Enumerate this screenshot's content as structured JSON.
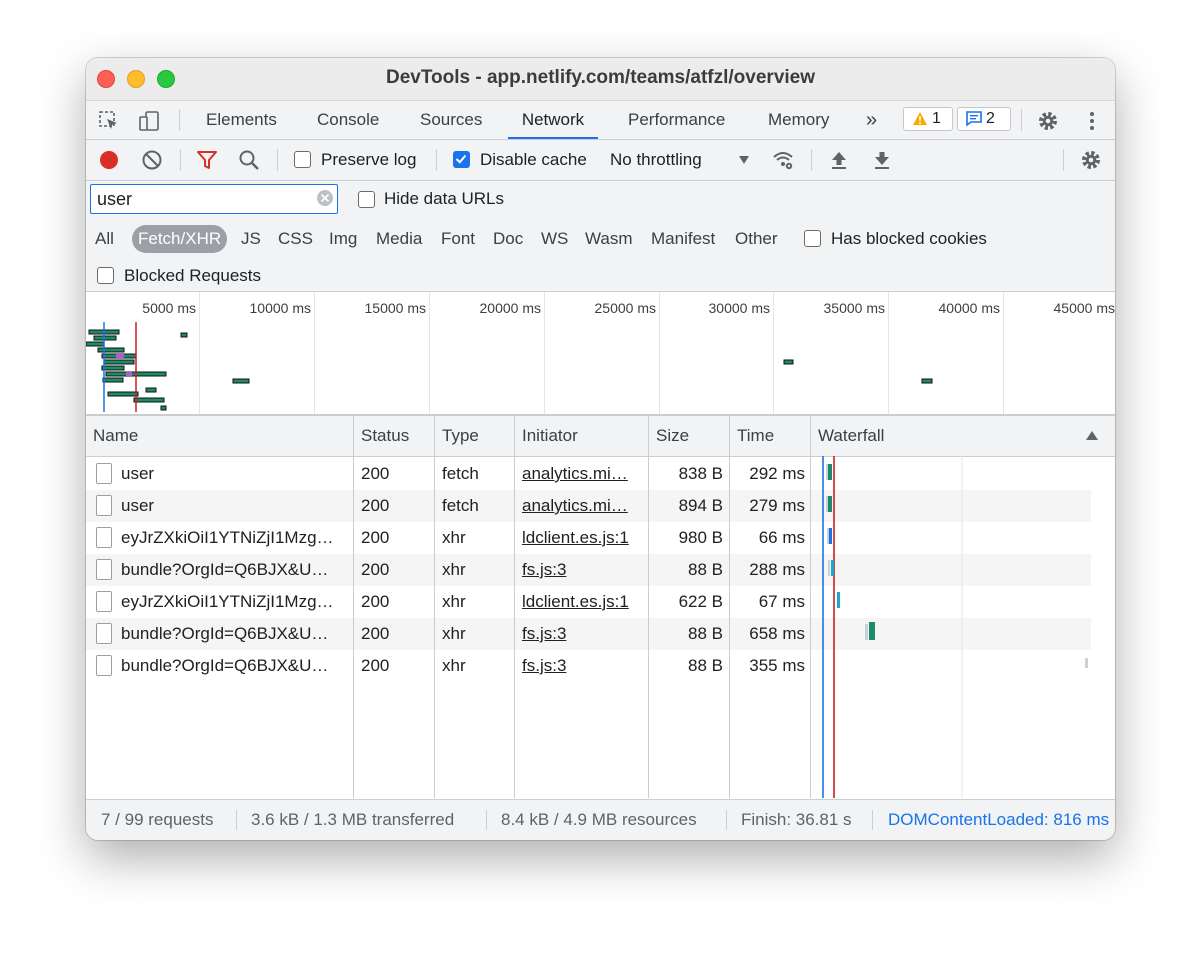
{
  "window": {
    "title": "DevTools - app.netlify.com/teams/atfzl/overview"
  },
  "tabs": [
    {
      "label": "Elements"
    },
    {
      "label": "Console"
    },
    {
      "label": "Sources"
    },
    {
      "label": "Network"
    },
    {
      "label": "Performance"
    },
    {
      "label": "Memory"
    }
  ],
  "tabbar": {
    "more_label": "»",
    "warnings_count": "1",
    "messages_count": "2"
  },
  "toolbar": {
    "preserve_log": {
      "label": "Preserve log",
      "checked": false
    },
    "disable_cache": {
      "label": "Disable cache",
      "checked": true
    },
    "throttling": "No throttling"
  },
  "filter": {
    "search_value": "user",
    "hide_data_urls": {
      "label": "Hide data URLs",
      "checked": false
    },
    "types": [
      "All",
      "Fetch/XHR",
      "JS",
      "CSS",
      "Img",
      "Media",
      "Font",
      "Doc",
      "WS",
      "Wasm",
      "Manifest",
      "Other"
    ],
    "selected_type": "Fetch/XHR",
    "has_blocked_cookies": {
      "label": "Has blocked cookies",
      "checked": false
    },
    "blocked_requests": {
      "label": "Blocked Requests",
      "checked": false
    }
  },
  "overview": {
    "ticks": [
      "5000 ms",
      "10000 ms",
      "15000 ms",
      "20000 ms",
      "25000 ms",
      "30000 ms",
      "35000 ms",
      "40000 ms",
      "45000 ms"
    ]
  },
  "table": {
    "columns": [
      "Name",
      "Status",
      "Type",
      "Initiator",
      "Size",
      "Time",
      "Waterfall"
    ],
    "rows": [
      {
        "name": "user",
        "status": "200",
        "type": "fetch",
        "initiator": "analytics.mi…",
        "size": "838 B",
        "time": "292 ms"
      },
      {
        "name": "user",
        "status": "200",
        "type": "fetch",
        "initiator": "analytics.mi…",
        "size": "894 B",
        "time": "279 ms"
      },
      {
        "name": "eyJrZXkiOiI1YTNiZjI1Mzg…",
        "status": "200",
        "type": "xhr",
        "initiator": "ldclient.es.js:1",
        "size": "980 B",
        "time": "66 ms"
      },
      {
        "name": "bundle?OrgId=Q6BJX&U…",
        "status": "200",
        "type": "xhr",
        "initiator": "fs.js:3",
        "size": "88 B",
        "time": "288 ms"
      },
      {
        "name": "eyJrZXkiOiI1YTNiZjI1Mzg…",
        "status": "200",
        "type": "xhr",
        "initiator": "ldclient.es.js:1",
        "size": "622 B",
        "time": "67 ms"
      },
      {
        "name": "bundle?OrgId=Q6BJX&U…",
        "status": "200",
        "type": "xhr",
        "initiator": "fs.js:3",
        "size": "88 B",
        "time": "658 ms"
      },
      {
        "name": "bundle?OrgId=Q6BJX&U…",
        "status": "200",
        "type": "xhr",
        "initiator": "fs.js:3",
        "size": "88 B",
        "time": "355 ms"
      }
    ]
  },
  "status": {
    "requests": "7 / 99 requests",
    "transferred": "3.6 kB / 1.3 MB transferred",
    "resources": "8.4 kB / 4.9 MB resources",
    "finish": "Finish: 36.81 s",
    "domcontentloaded": "DOMContentLoaded: 816 ms"
  },
  "colors": {
    "accent": "#1a73e8",
    "dcl_line": "#1a73e8",
    "load_line": "#c5221f",
    "bar_green": "#1d8a6a"
  }
}
